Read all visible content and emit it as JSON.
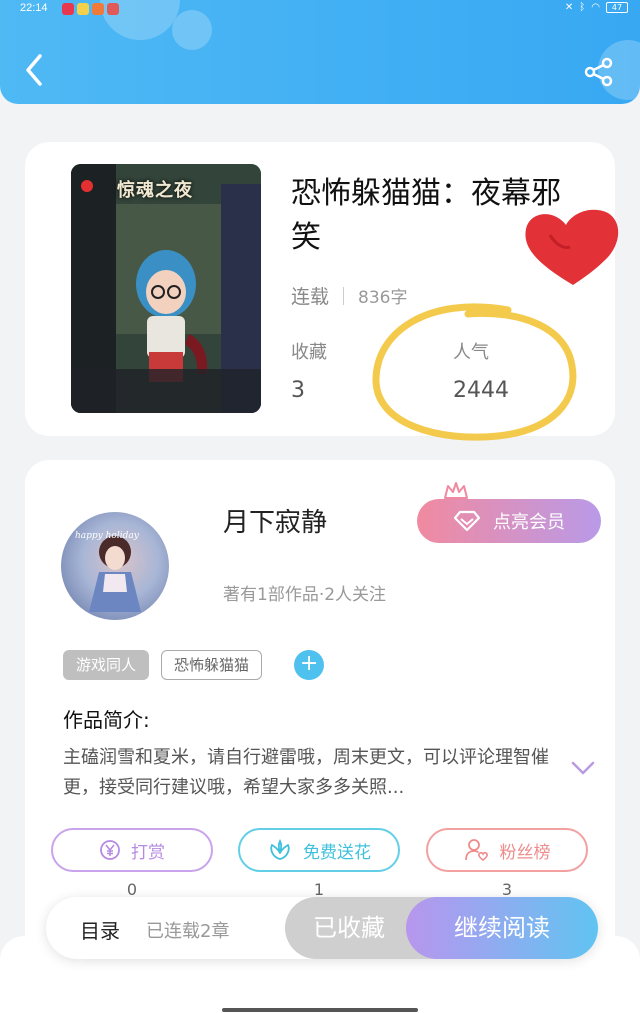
{
  "status_bar": {
    "time": "22:14",
    "battery": "47"
  },
  "header": {
    "back_icon": "chevron-left-icon",
    "share_icon": "share-icon",
    "color": "#42b0f4"
  },
  "book": {
    "cover_title": "惊魂之夜",
    "title": "恐怖躲猫猫：夜幕邪笑",
    "status": "连载",
    "word_count": "836字",
    "stats": [
      {
        "label": "收藏",
        "value": "3"
      },
      {
        "label": "人气",
        "value": "2444"
      }
    ]
  },
  "author": {
    "name": "月下寂静",
    "meta": "著有1部作品·2人关注",
    "vip_label": "点亮会员",
    "avatar_text": "happy holiday",
    "tags": [
      "游戏同人",
      "恐怖躲猫猫"
    ],
    "intro_title": "作品简介:",
    "intro_text": "主磕润雪和夏米，请自行避雷哦，周末更文，可以评论理智催更，接受同行建议哦，希望大家多多关照..."
  },
  "actions": [
    {
      "label": "打赏",
      "icon": "yen-coin-icon",
      "count": "0",
      "color": "#b68be4"
    },
    {
      "label": "免费送花",
      "icon": "flower-icon",
      "count": "1",
      "color": "#3fc1dd"
    },
    {
      "label": "粉丝榜",
      "icon": "person-heart-icon",
      "count": "3",
      "color": "#ee8c8c"
    }
  ],
  "bottom_bar": {
    "toc_label": "目录",
    "toc_status": "已连载2章",
    "collected_label": "已收藏",
    "continue_label": "继续阅读"
  }
}
